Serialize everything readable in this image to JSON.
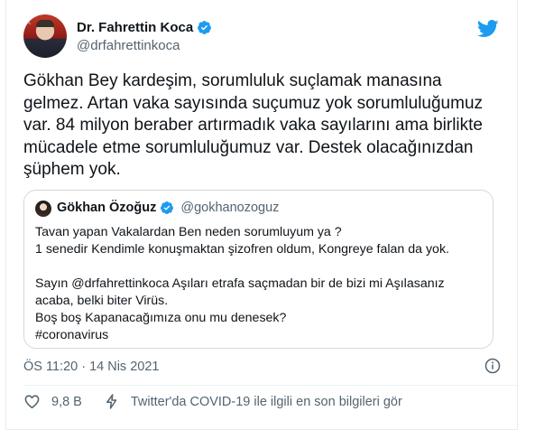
{
  "author": {
    "name": "Dr. Fahrettin Koca",
    "handle": "@drfahrettinkoca",
    "verified": true
  },
  "tweet": {
    "text": "Gökhan Bey kardeşim, sorumluluk suçlamak manasına\ngelmez. Artan vaka sayısında suçumuz yok sorumluluğumuz\nvar. 84 milyon beraber artırmadık vaka sayılarını ama birlikte\nmücadele etme sorumluluğumuz var. Destek olacağınızdan\nşüphem yok."
  },
  "quoted": {
    "name": "Gökhan Özoğuz",
    "handle": "@gokhanozoguz",
    "lines": [
      "Tavan yapan Vakalardan Ben neden sorumluyum ya ?",
      "1 senedir Kendimle konuşmaktan şizofren oldum, Kongreye falan da yok.",
      "",
      "Sayın @drfahrettinkoca Aşıları etrafa saçmadan bir de bizi mi Aşılasanız",
      "acaba, belki biter Virüs.",
      "Boş boş Kapanacağımıza onu mu denesek?",
      "#coronavirus"
    ]
  },
  "meta": {
    "time": "ÖS 11:20 · 14 Nis 2021"
  },
  "actions": {
    "like_count": "9,8 B",
    "covid_info": "Twitter'da COVID-19 ile ilgili en son bilgileri gör"
  },
  "colors": {
    "brand_blue": "#1d9bf0",
    "text": "#0f1419",
    "secondary": "#536471",
    "border": "#cfd9de"
  },
  "icons": [
    "verified-badge-icon",
    "twitter-bird-icon",
    "info-icon",
    "heart-icon",
    "lightning-bolt-icon"
  ]
}
